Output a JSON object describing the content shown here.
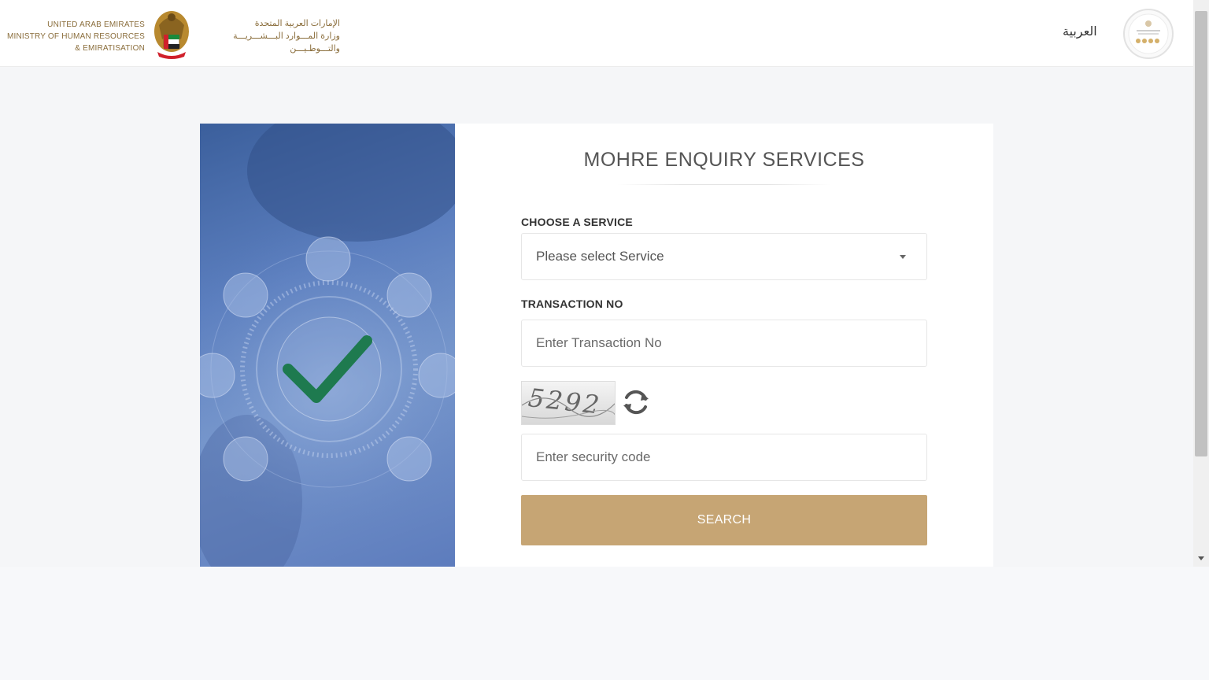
{
  "header": {
    "logo_en_lines": [
      "UNITED ARAB EMIRATES",
      "MINISTRY OF HUMAN RESOURCES",
      "& EMIRATISATION"
    ],
    "logo_ar_lines": [
      "الإمارات العربية المتحدة",
      "وزارة المـــوارد البـــشـــريـــة",
      "والتـــوطـيـــن"
    ],
    "language_link": "العربية",
    "emblem_icon": "uae-falcon-emblem-icon",
    "seal_icon": "star-rating-seal-icon"
  },
  "form": {
    "title": "MOHRE ENQUIRY SERVICES",
    "service_label": "CHOOSE A SERVICE",
    "service_selected": "Please select Service",
    "transaction_label": "TRANSACTION NO",
    "transaction_placeholder": "Enter Transaction No",
    "captcha_text": "5292",
    "security_placeholder": "Enter security code",
    "search_label": "SEARCH"
  },
  "colors": {
    "accent_gold": "#c6a574",
    "brand_brown": "#8a6d3b",
    "check_green": "#1e7a4f",
    "panel_blue": "#5c7fbf"
  }
}
